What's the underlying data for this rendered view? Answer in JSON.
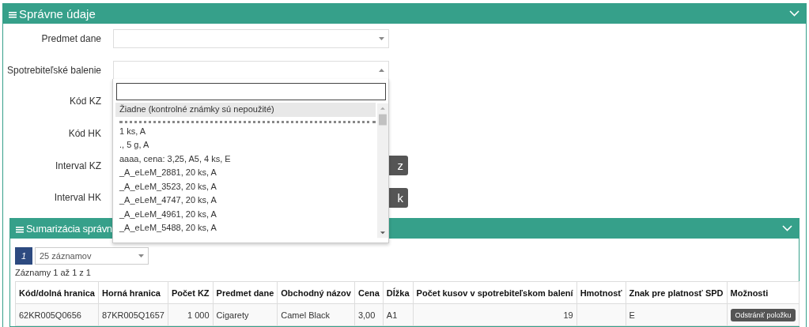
{
  "panel": {
    "title": "Správne údaje",
    "form": [
      {
        "kind": "select",
        "label": "Predmet dane",
        "open": false
      },
      {
        "kind": "select",
        "label": "Spotrebiteľské balenie",
        "open": true
      },
      {
        "kind": "hidden",
        "label": "Kód KZ"
      },
      {
        "kind": "hidden",
        "label": "Kód HK"
      },
      {
        "kind": "button",
        "label": "Interval KZ",
        "button": "z"
      },
      {
        "kind": "button",
        "label": "Interval HK",
        "button": "k"
      }
    ],
    "dropdown": {
      "items": [
        {
          "kind": "option",
          "text": "Žiadne (kontrolné známky sú nepoužité)",
          "selected": true
        },
        {
          "kind": "separator"
        },
        {
          "kind": "option",
          "text": "1 ks, A",
          "selected": false
        },
        {
          "kind": "option",
          "text": "., 5 g, A",
          "selected": false
        },
        {
          "kind": "option",
          "text": "aaaa, cena: 3,25, A5, 4 ks, E",
          "selected": false
        },
        {
          "kind": "option",
          "text": "_A_eLeM_2881, 20 ks, A",
          "selected": false
        },
        {
          "kind": "option",
          "text": "_A_eLeM_3523, 20 ks, A",
          "selected": false
        },
        {
          "kind": "option",
          "text": "_A_eLeM_4747, 20 ks, A",
          "selected": false
        },
        {
          "kind": "option",
          "text": "_A_eLeM_4961, 20 ks, A",
          "selected": false
        },
        {
          "kind": "option",
          "text": "_A_eLeM_5488, 20 ks, A",
          "selected": false
        }
      ]
    },
    "summary": {
      "title": "Sumarizácia správn",
      "pages": [
        {
          "label": "1",
          "selected": true
        }
      ],
      "page_size": "25 záznamov",
      "info": "Záznamy 1 až 1 z 1",
      "table": {
        "columns": [
          "Kód/dolná hranica",
          "Horná hranica",
          "Počet KZ",
          "Predmet dane",
          "Obchodný názov",
          "Cena",
          "Dĺžka",
          "Počet kusov v spotrebiteľskom balení",
          "Hmotnosť",
          "Znak pre platnosť SPD",
          "Možnosti"
        ],
        "rows": [
          {
            "cells": [
              "62KR005Q0656",
              "87KR005Q1657",
              "1 000",
              "Cigarety",
              "Camel Black",
              "3,00",
              "A1",
              "19",
              null,
              "E"
            ],
            "action": "Odstrániť položku"
          }
        ]
      }
    }
  }
}
